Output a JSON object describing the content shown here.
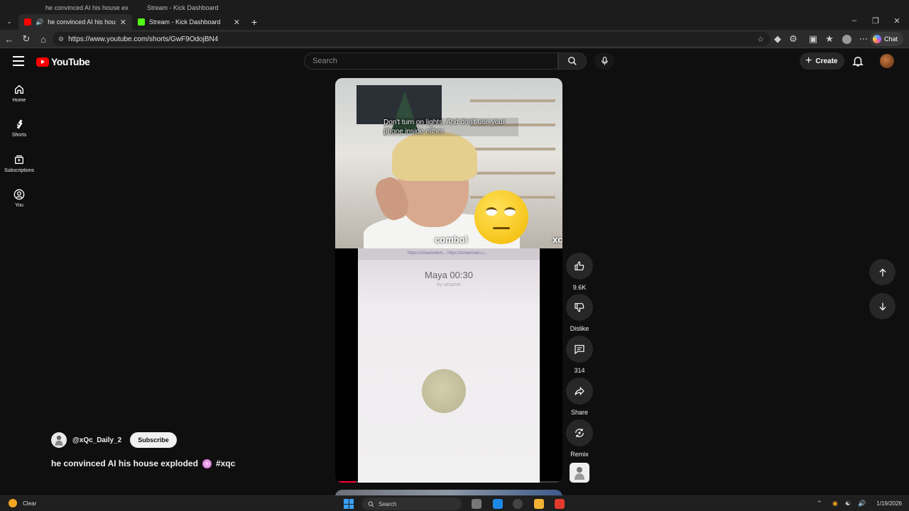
{
  "browser": {
    "ghost_tabs": [
      {
        "title": "he convinced AI his house ex"
      },
      {
        "title": "Stream - Kick Dashboard"
      }
    ],
    "tabs": [
      {
        "title": "he convinced AI his house exp",
        "favicon_color": "#ff0000",
        "active": true
      },
      {
        "title": "Stream - Kick Dashboard",
        "favicon_color": "#53fc18",
        "active": false
      }
    ],
    "new_tab": "+",
    "url": "https://www.youtube.com/shorts/GwF9OdojBN4",
    "chat_label": "Chat"
  },
  "youtube": {
    "logo_text": "YouTube",
    "search_placeholder": "Search",
    "create_label": "Create",
    "rail": [
      {
        "label": "Home",
        "icon": "home-icon"
      },
      {
        "label": "Shorts",
        "icon": "shorts-icon"
      },
      {
        "label": "Subscriptions",
        "icon": "subscriptions-icon"
      },
      {
        "label": "You",
        "icon": "you-icon"
      }
    ]
  },
  "short": {
    "caption": "Don't turn on lights. And don't use your phone inside either.",
    "overlay_mirrored": "lodmoɔ",
    "overlay_mirrored_corner": "ɔx",
    "phone": {
      "url_hint": "https://streamelem...   https://streamlabs.c...",
      "call_name": "Maya 00:30",
      "call_sub": "by sesame"
    },
    "progress": 0.08,
    "channel": "@xQc_Daily_2",
    "subscribe_label": "Subscribe",
    "title": "he convinced AI his house exploded",
    "hashtag": "#xqc"
  },
  "actions": {
    "like_count": "9.6K",
    "dislike_label": "Dislike",
    "comment_count": "314",
    "share_label": "Share",
    "remix_label": "Remix"
  },
  "taskbar": {
    "weather": "Clear",
    "search": "Search",
    "date": "1/19/2026"
  },
  "colors": {
    "background": "#0f0f0f",
    "youtube_red": "#ff0000",
    "progress_red": "#ff0033"
  }
}
